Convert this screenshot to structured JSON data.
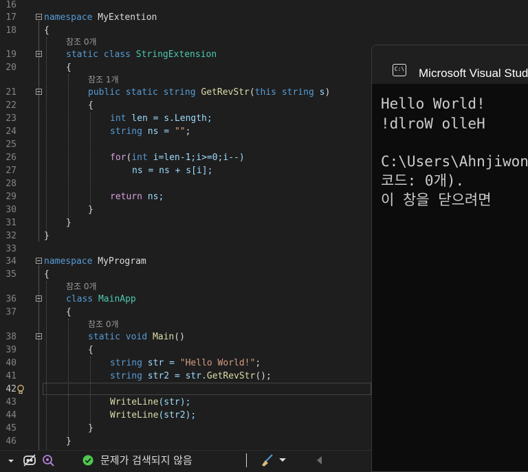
{
  "editor": {
    "line_numbers": [
      "16",
      "17",
      "18",
      "19",
      "20",
      "21",
      "22",
      "23",
      "24",
      "25",
      "26",
      "27",
      "28",
      "29",
      "30",
      "31",
      "32",
      "33",
      "34",
      "35",
      "36",
      "37",
      "38",
      "39",
      "40",
      "41",
      "42",
      "43",
      "44",
      "45",
      "46"
    ],
    "current_line": "42",
    "codelens": [
      "참조 0개",
      "참조 1개",
      "참조 0개",
      "참조 0개"
    ],
    "tokens": {
      "ns1_kw": "namespace",
      "ns1_name": "MyExtention",
      "brace_open": "{",
      "brace_close": "}",
      "static": "static",
      "class": "class",
      "cls1": "StringExtension",
      "public": "public",
      "string": "string",
      "method1": "GetRevStr",
      "paren_open": "(",
      "this": "this",
      "param_s": " s",
      "int": "int",
      "len_decl": " len = s.Length;",
      "ns_decl": " ns = ",
      "empty_str": "\"\"",
      "semicolon": ";",
      "for_kw": "for",
      "for_rest": "(",
      "for_int": "int",
      "for_cond": " i=len-1;i>=0;i--)",
      "ns_assign": "ns = ns + s[i];",
      "return_kw": "return",
      "return_val": " ns;",
      "ns2_kw": "namespace",
      "ns2_name": "MyProgram",
      "cls2": "MainApp",
      "void": "void",
      "main": "Main",
      "main_parens": "()",
      "str_decl": " str = ",
      "hello": "\"Hello World!\"",
      "str2_decl": " str2 = str.",
      "call_rev": "GetRevStr",
      "call_end": "();",
      "writeline": "WriteLine",
      "wl1_args": "(str);",
      "wl2_args": "(str2);"
    }
  },
  "console": {
    "title": "Microsoft Visual Studio 디버그 콘솔",
    "icon_text": "C:\\",
    "lines": [
      "Hello World!",
      "!dlroW olleH",
      "",
      "C:\\Users\\Ahnjiwon",
      "코드: 0개).",
      "이 창을 닫으려면"
    ]
  },
  "statusbar": {
    "issues_text": "문제가 검색되지 않음",
    "colors": {
      "ok": "#4ec94e",
      "accent": "#569cd6"
    }
  }
}
